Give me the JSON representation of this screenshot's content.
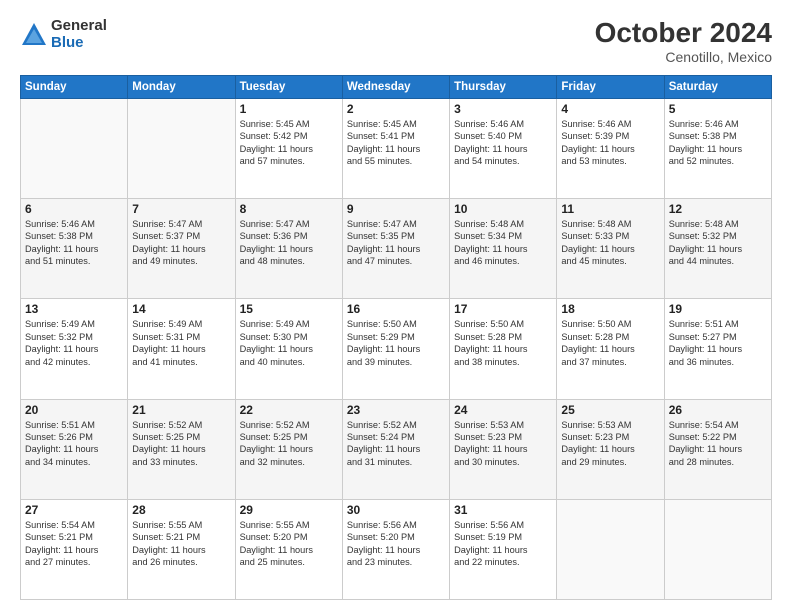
{
  "logo": {
    "general": "General",
    "blue": "Blue"
  },
  "title": "October 2024",
  "location": "Cenotillo, Mexico",
  "headers": [
    "Sunday",
    "Monday",
    "Tuesday",
    "Wednesday",
    "Thursday",
    "Friday",
    "Saturday"
  ],
  "weeks": [
    [
      {
        "day": "",
        "info": ""
      },
      {
        "day": "",
        "info": ""
      },
      {
        "day": "1",
        "info": "Sunrise: 5:45 AM\nSunset: 5:42 PM\nDaylight: 11 hours\nand 57 minutes."
      },
      {
        "day": "2",
        "info": "Sunrise: 5:45 AM\nSunset: 5:41 PM\nDaylight: 11 hours\nand 55 minutes."
      },
      {
        "day": "3",
        "info": "Sunrise: 5:46 AM\nSunset: 5:40 PM\nDaylight: 11 hours\nand 54 minutes."
      },
      {
        "day": "4",
        "info": "Sunrise: 5:46 AM\nSunset: 5:39 PM\nDaylight: 11 hours\nand 53 minutes."
      },
      {
        "day": "5",
        "info": "Sunrise: 5:46 AM\nSunset: 5:38 PM\nDaylight: 11 hours\nand 52 minutes."
      }
    ],
    [
      {
        "day": "6",
        "info": "Sunrise: 5:46 AM\nSunset: 5:38 PM\nDaylight: 11 hours\nand 51 minutes."
      },
      {
        "day": "7",
        "info": "Sunrise: 5:47 AM\nSunset: 5:37 PM\nDaylight: 11 hours\nand 49 minutes."
      },
      {
        "day": "8",
        "info": "Sunrise: 5:47 AM\nSunset: 5:36 PM\nDaylight: 11 hours\nand 48 minutes."
      },
      {
        "day": "9",
        "info": "Sunrise: 5:47 AM\nSunset: 5:35 PM\nDaylight: 11 hours\nand 47 minutes."
      },
      {
        "day": "10",
        "info": "Sunrise: 5:48 AM\nSunset: 5:34 PM\nDaylight: 11 hours\nand 46 minutes."
      },
      {
        "day": "11",
        "info": "Sunrise: 5:48 AM\nSunset: 5:33 PM\nDaylight: 11 hours\nand 45 minutes."
      },
      {
        "day": "12",
        "info": "Sunrise: 5:48 AM\nSunset: 5:32 PM\nDaylight: 11 hours\nand 44 minutes."
      }
    ],
    [
      {
        "day": "13",
        "info": "Sunrise: 5:49 AM\nSunset: 5:32 PM\nDaylight: 11 hours\nand 42 minutes."
      },
      {
        "day": "14",
        "info": "Sunrise: 5:49 AM\nSunset: 5:31 PM\nDaylight: 11 hours\nand 41 minutes."
      },
      {
        "day": "15",
        "info": "Sunrise: 5:49 AM\nSunset: 5:30 PM\nDaylight: 11 hours\nand 40 minutes."
      },
      {
        "day": "16",
        "info": "Sunrise: 5:50 AM\nSunset: 5:29 PM\nDaylight: 11 hours\nand 39 minutes."
      },
      {
        "day": "17",
        "info": "Sunrise: 5:50 AM\nSunset: 5:28 PM\nDaylight: 11 hours\nand 38 minutes."
      },
      {
        "day": "18",
        "info": "Sunrise: 5:50 AM\nSunset: 5:28 PM\nDaylight: 11 hours\nand 37 minutes."
      },
      {
        "day": "19",
        "info": "Sunrise: 5:51 AM\nSunset: 5:27 PM\nDaylight: 11 hours\nand 36 minutes."
      }
    ],
    [
      {
        "day": "20",
        "info": "Sunrise: 5:51 AM\nSunset: 5:26 PM\nDaylight: 11 hours\nand 34 minutes."
      },
      {
        "day": "21",
        "info": "Sunrise: 5:52 AM\nSunset: 5:25 PM\nDaylight: 11 hours\nand 33 minutes."
      },
      {
        "day": "22",
        "info": "Sunrise: 5:52 AM\nSunset: 5:25 PM\nDaylight: 11 hours\nand 32 minutes."
      },
      {
        "day": "23",
        "info": "Sunrise: 5:52 AM\nSunset: 5:24 PM\nDaylight: 11 hours\nand 31 minutes."
      },
      {
        "day": "24",
        "info": "Sunrise: 5:53 AM\nSunset: 5:23 PM\nDaylight: 11 hours\nand 30 minutes."
      },
      {
        "day": "25",
        "info": "Sunrise: 5:53 AM\nSunset: 5:23 PM\nDaylight: 11 hours\nand 29 minutes."
      },
      {
        "day": "26",
        "info": "Sunrise: 5:54 AM\nSunset: 5:22 PM\nDaylight: 11 hours\nand 28 minutes."
      }
    ],
    [
      {
        "day": "27",
        "info": "Sunrise: 5:54 AM\nSunset: 5:21 PM\nDaylight: 11 hours\nand 27 minutes."
      },
      {
        "day": "28",
        "info": "Sunrise: 5:55 AM\nSunset: 5:21 PM\nDaylight: 11 hours\nand 26 minutes."
      },
      {
        "day": "29",
        "info": "Sunrise: 5:55 AM\nSunset: 5:20 PM\nDaylight: 11 hours\nand 25 minutes."
      },
      {
        "day": "30",
        "info": "Sunrise: 5:56 AM\nSunset: 5:20 PM\nDaylight: 11 hours\nand 23 minutes."
      },
      {
        "day": "31",
        "info": "Sunrise: 5:56 AM\nSunset: 5:19 PM\nDaylight: 11 hours\nand 22 minutes."
      },
      {
        "day": "",
        "info": ""
      },
      {
        "day": "",
        "info": ""
      }
    ]
  ]
}
